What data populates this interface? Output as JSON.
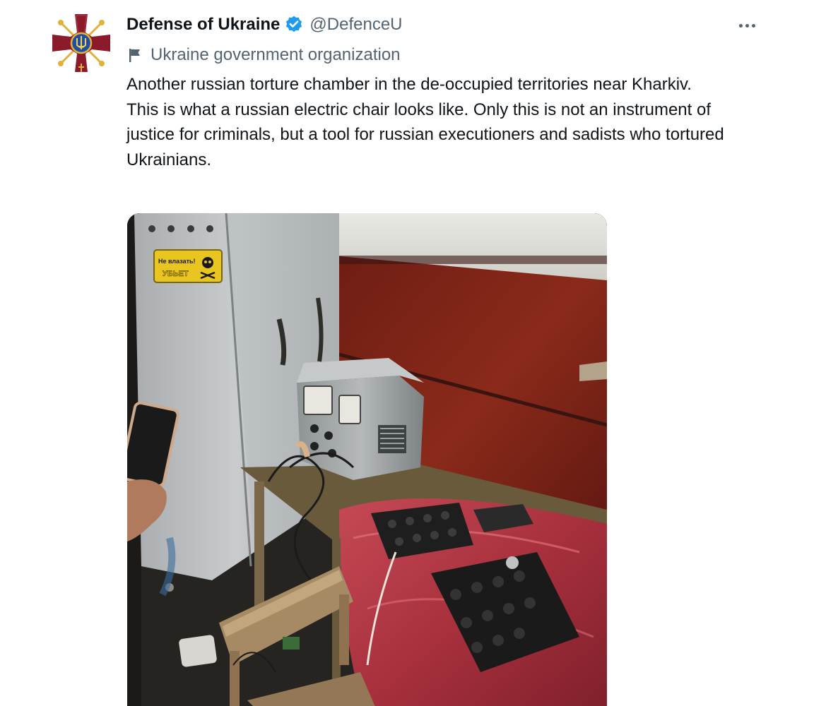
{
  "tweet": {
    "display_name": "Defense of Ukraine",
    "handle": "@DefenceU",
    "affiliation": "Ukraine government organization",
    "text_lines": [
      "Another russian torture chamber in the de-occupied territories near Kharkiv.",
      "This is what a russian electric chair looks like. Only this is not an instrument of justice for criminals, but a tool for russian executioners and sadists who tortured Ukrainians."
    ],
    "media": {
      "sign_text": "Не влазать!",
      "sign_subtext": "УБЬЕТ"
    }
  },
  "icons": {
    "avatar": "military-cross-emblem",
    "verified": "verified-badge-icon",
    "affiliation": "flag-icon",
    "more": "more-icon"
  },
  "colors": {
    "text_primary": "#0f1419",
    "text_secondary": "#536471",
    "verified_blue": "#1d9bf0",
    "avatar_red": "#8b1a2a",
    "avatar_gold": "#e2b13c"
  }
}
